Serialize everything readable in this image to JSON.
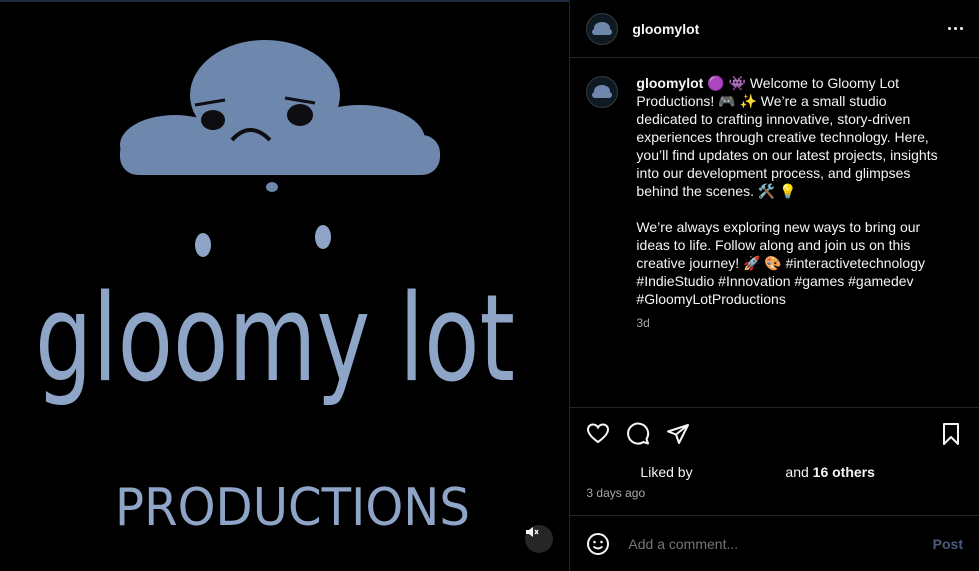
{
  "post": {
    "username": "gloomylot",
    "more_icon": "more-horizontal-icon"
  },
  "media": {
    "image_text": "gloomy lot PRODUCTIONS",
    "mute_icon": "speaker-muted-icon"
  },
  "caption": {
    "username": "gloomylot",
    "text": " 🟣 👾 Welcome to Gloomy Lot Productions! 🎮 ✨ We’re a small studio dedicated to crafting innovative, story-driven experiences through creative technology. Here, you’ll find updates on our latest projects, insights into our development process, and glimpses behind the scenes. 🛠️ 💡\n\nWe’re always exploring new ways to bring our ideas to life. Follow along and join us on this creative journey! 🚀 🎨 #interactivetechnology #IndieStudio #Innovation #games #gamedev #GloomyLotProductions",
    "time": "3d"
  },
  "actions": {
    "icons": [
      "heart-icon",
      "comment-icon",
      "share-icon",
      "bookmark-icon"
    ]
  },
  "likes": {
    "liked_by": "Liked by",
    "and": "and",
    "others": "16 others"
  },
  "timestamp": "3 days ago",
  "comment_box": {
    "placeholder": "Add a comment...",
    "post_label": "Post",
    "emoji_icon": "emoji-icon"
  },
  "colors": {
    "background": "#000000",
    "border": "#262626",
    "secondary_text": "#a8a8a8",
    "post_button": "#4a5b7a",
    "artwork_blue": "#8ea5c8"
  }
}
